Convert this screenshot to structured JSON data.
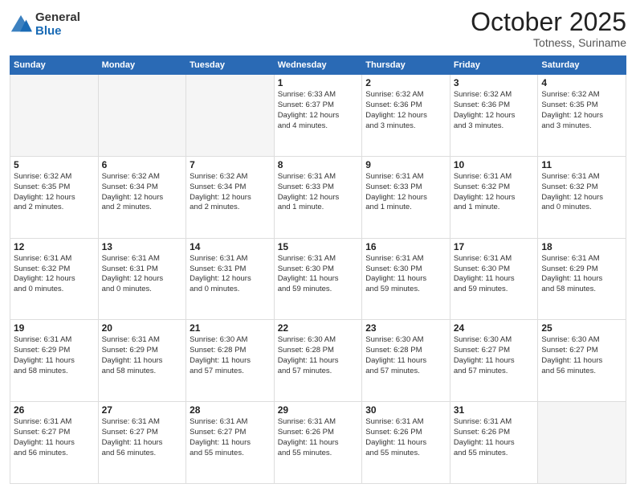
{
  "header": {
    "logo_general": "General",
    "logo_blue": "Blue",
    "month": "October 2025",
    "location": "Totness, Suriname"
  },
  "days_of_week": [
    "Sunday",
    "Monday",
    "Tuesday",
    "Wednesday",
    "Thursday",
    "Friday",
    "Saturday"
  ],
  "weeks": [
    [
      {
        "day": "",
        "lines": []
      },
      {
        "day": "",
        "lines": []
      },
      {
        "day": "",
        "lines": []
      },
      {
        "day": "1",
        "lines": [
          "Sunrise: 6:33 AM",
          "Sunset: 6:37 PM",
          "Daylight: 12 hours",
          "and 4 minutes."
        ]
      },
      {
        "day": "2",
        "lines": [
          "Sunrise: 6:32 AM",
          "Sunset: 6:36 PM",
          "Daylight: 12 hours",
          "and 3 minutes."
        ]
      },
      {
        "day": "3",
        "lines": [
          "Sunrise: 6:32 AM",
          "Sunset: 6:36 PM",
          "Daylight: 12 hours",
          "and 3 minutes."
        ]
      },
      {
        "day": "4",
        "lines": [
          "Sunrise: 6:32 AM",
          "Sunset: 6:35 PM",
          "Daylight: 12 hours",
          "and 3 minutes."
        ]
      }
    ],
    [
      {
        "day": "5",
        "lines": [
          "Sunrise: 6:32 AM",
          "Sunset: 6:35 PM",
          "Daylight: 12 hours",
          "and 2 minutes."
        ]
      },
      {
        "day": "6",
        "lines": [
          "Sunrise: 6:32 AM",
          "Sunset: 6:34 PM",
          "Daylight: 12 hours",
          "and 2 minutes."
        ]
      },
      {
        "day": "7",
        "lines": [
          "Sunrise: 6:32 AM",
          "Sunset: 6:34 PM",
          "Daylight: 12 hours",
          "and 2 minutes."
        ]
      },
      {
        "day": "8",
        "lines": [
          "Sunrise: 6:31 AM",
          "Sunset: 6:33 PM",
          "Daylight: 12 hours",
          "and 1 minute."
        ]
      },
      {
        "day": "9",
        "lines": [
          "Sunrise: 6:31 AM",
          "Sunset: 6:33 PM",
          "Daylight: 12 hours",
          "and 1 minute."
        ]
      },
      {
        "day": "10",
        "lines": [
          "Sunrise: 6:31 AM",
          "Sunset: 6:32 PM",
          "Daylight: 12 hours",
          "and 1 minute."
        ]
      },
      {
        "day": "11",
        "lines": [
          "Sunrise: 6:31 AM",
          "Sunset: 6:32 PM",
          "Daylight: 12 hours",
          "and 0 minutes."
        ]
      }
    ],
    [
      {
        "day": "12",
        "lines": [
          "Sunrise: 6:31 AM",
          "Sunset: 6:32 PM",
          "Daylight: 12 hours",
          "and 0 minutes."
        ]
      },
      {
        "day": "13",
        "lines": [
          "Sunrise: 6:31 AM",
          "Sunset: 6:31 PM",
          "Daylight: 12 hours",
          "and 0 minutes."
        ]
      },
      {
        "day": "14",
        "lines": [
          "Sunrise: 6:31 AM",
          "Sunset: 6:31 PM",
          "Daylight: 12 hours",
          "and 0 minutes."
        ]
      },
      {
        "day": "15",
        "lines": [
          "Sunrise: 6:31 AM",
          "Sunset: 6:30 PM",
          "Daylight: 11 hours",
          "and 59 minutes."
        ]
      },
      {
        "day": "16",
        "lines": [
          "Sunrise: 6:31 AM",
          "Sunset: 6:30 PM",
          "Daylight: 11 hours",
          "and 59 minutes."
        ]
      },
      {
        "day": "17",
        "lines": [
          "Sunrise: 6:31 AM",
          "Sunset: 6:30 PM",
          "Daylight: 11 hours",
          "and 59 minutes."
        ]
      },
      {
        "day": "18",
        "lines": [
          "Sunrise: 6:31 AM",
          "Sunset: 6:29 PM",
          "Daylight: 11 hours",
          "and 58 minutes."
        ]
      }
    ],
    [
      {
        "day": "19",
        "lines": [
          "Sunrise: 6:31 AM",
          "Sunset: 6:29 PM",
          "Daylight: 11 hours",
          "and 58 minutes."
        ]
      },
      {
        "day": "20",
        "lines": [
          "Sunrise: 6:31 AM",
          "Sunset: 6:29 PM",
          "Daylight: 11 hours",
          "and 58 minutes."
        ]
      },
      {
        "day": "21",
        "lines": [
          "Sunrise: 6:30 AM",
          "Sunset: 6:28 PM",
          "Daylight: 11 hours",
          "and 57 minutes."
        ]
      },
      {
        "day": "22",
        "lines": [
          "Sunrise: 6:30 AM",
          "Sunset: 6:28 PM",
          "Daylight: 11 hours",
          "and 57 minutes."
        ]
      },
      {
        "day": "23",
        "lines": [
          "Sunrise: 6:30 AM",
          "Sunset: 6:28 PM",
          "Daylight: 11 hours",
          "and 57 minutes."
        ]
      },
      {
        "day": "24",
        "lines": [
          "Sunrise: 6:30 AM",
          "Sunset: 6:27 PM",
          "Daylight: 11 hours",
          "and 57 minutes."
        ]
      },
      {
        "day": "25",
        "lines": [
          "Sunrise: 6:30 AM",
          "Sunset: 6:27 PM",
          "Daylight: 11 hours",
          "and 56 minutes."
        ]
      }
    ],
    [
      {
        "day": "26",
        "lines": [
          "Sunrise: 6:31 AM",
          "Sunset: 6:27 PM",
          "Daylight: 11 hours",
          "and 56 minutes."
        ]
      },
      {
        "day": "27",
        "lines": [
          "Sunrise: 6:31 AM",
          "Sunset: 6:27 PM",
          "Daylight: 11 hours",
          "and 56 minutes."
        ]
      },
      {
        "day": "28",
        "lines": [
          "Sunrise: 6:31 AM",
          "Sunset: 6:27 PM",
          "Daylight: 11 hours",
          "and 55 minutes."
        ]
      },
      {
        "day": "29",
        "lines": [
          "Sunrise: 6:31 AM",
          "Sunset: 6:26 PM",
          "Daylight: 11 hours",
          "and 55 minutes."
        ]
      },
      {
        "day": "30",
        "lines": [
          "Sunrise: 6:31 AM",
          "Sunset: 6:26 PM",
          "Daylight: 11 hours",
          "and 55 minutes."
        ]
      },
      {
        "day": "31",
        "lines": [
          "Sunrise: 6:31 AM",
          "Sunset: 6:26 PM",
          "Daylight: 11 hours",
          "and 55 minutes."
        ]
      },
      {
        "day": "",
        "lines": []
      }
    ]
  ]
}
